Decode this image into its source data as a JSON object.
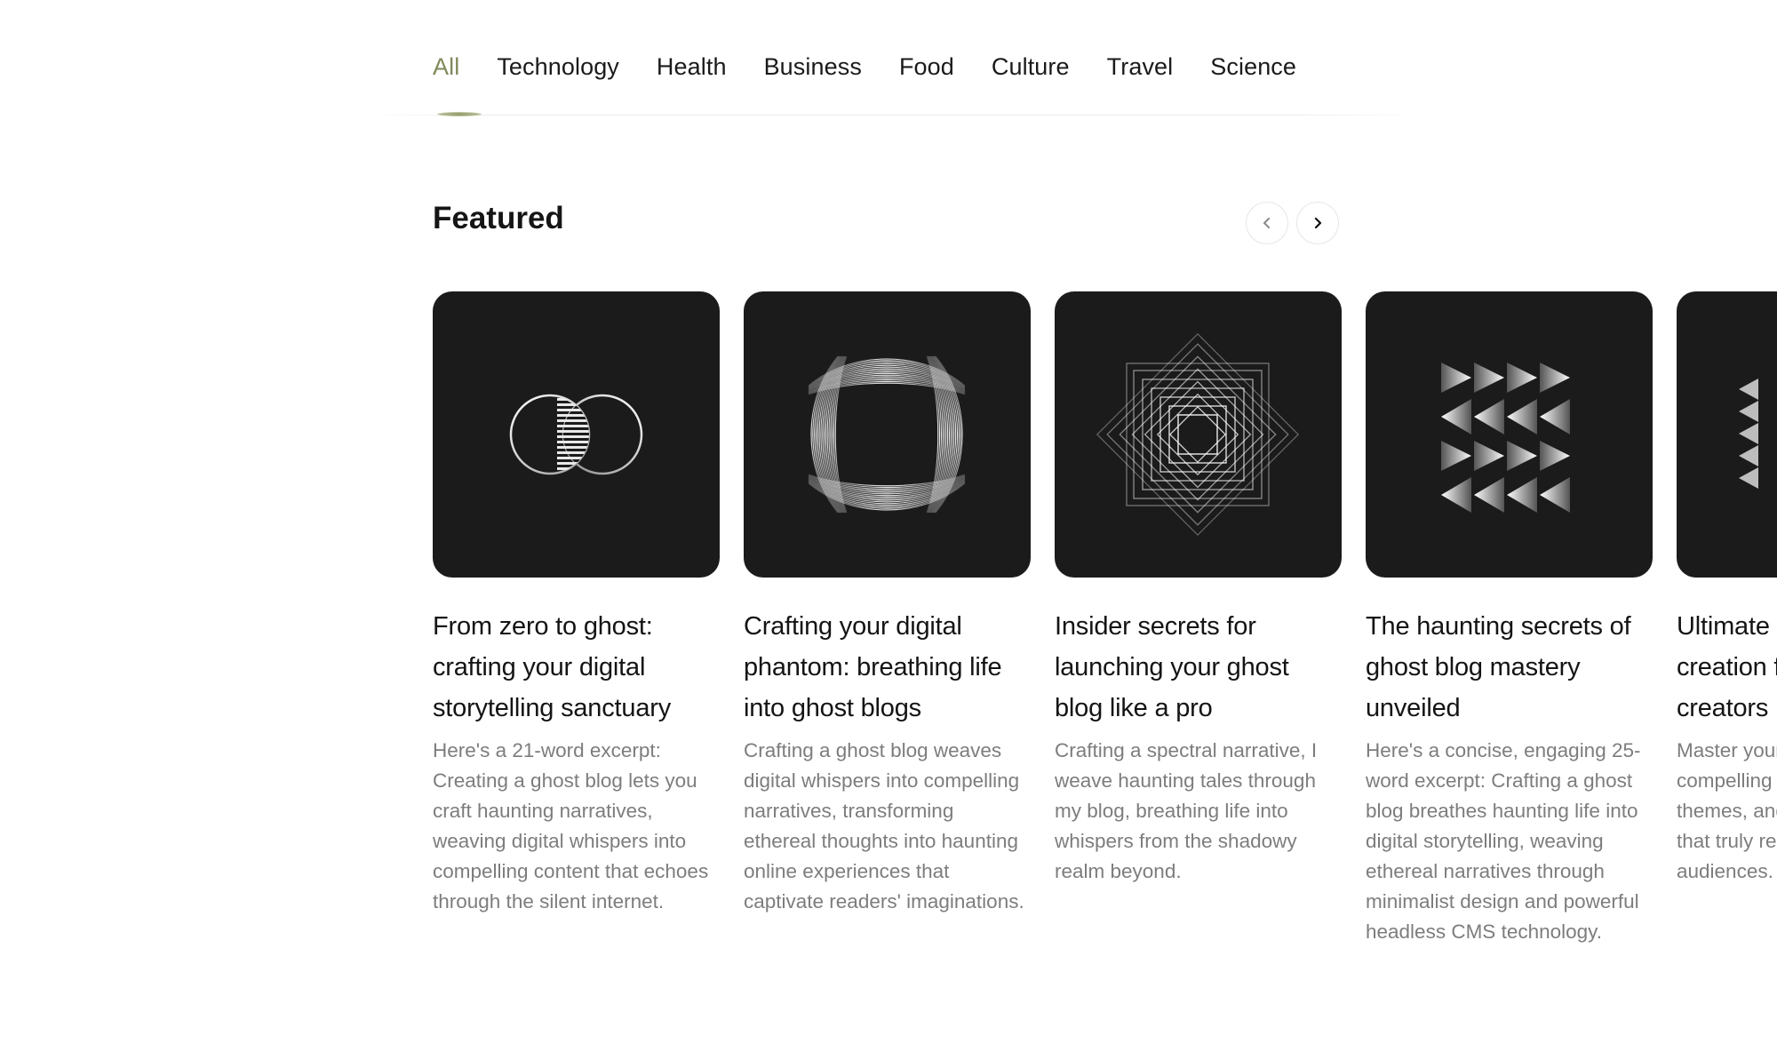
{
  "categories": [
    {
      "label": "All",
      "active": true
    },
    {
      "label": "Technology",
      "active": false
    },
    {
      "label": "Health",
      "active": false
    },
    {
      "label": "Business",
      "active": false
    },
    {
      "label": "Food",
      "active": false
    },
    {
      "label": "Culture",
      "active": false
    },
    {
      "label": "Travel",
      "active": false
    },
    {
      "label": "Science",
      "active": false
    }
  ],
  "featured": {
    "title": "Featured",
    "prev_icon": "chevron-left-icon",
    "next_icon": "chevron-right-icon"
  },
  "cards": [
    {
      "title": "From zero to ghost: crafting your digital storytelling sanctuary",
      "excerpt": "Here's a 21-word excerpt: Creating a ghost blog lets you craft haunting narratives, weaving digital whispers into compelling content that echoes through the silent internet.",
      "art": "overlapping-circles-icon"
    },
    {
      "title": "Crafting your digital phantom: breathing life into ghost blogs",
      "excerpt": "Crafting a ghost blog weaves digital whispers into compelling narratives, transforming ethereal thoughts into haunting online experiences that captivate readers' imaginations.",
      "art": "curved-lines-icon"
    },
    {
      "title": "Insider secrets for launching your ghost blog like a pro",
      "excerpt": "Crafting a spectral narrative, I weave haunting tales through my blog, breathing life into whispers from the shadowy realm beyond.",
      "art": "nested-squares-icon"
    },
    {
      "title": "The haunting secrets of ghost blog mastery unveiled",
      "excerpt": "Here's a concise, engaging 25-word excerpt: Crafting a ghost blog breathes haunting life into digital storytelling, weaving ethereal narratives through minimalist design and powerful headless CMS technology.",
      "art": "triangles-icon"
    },
    {
      "title": "Ultimate guide to content creation for ghost creators",
      "excerpt": "Master your craft with compelling stories, consistent themes, and trends for content that truly resonates with audiences.",
      "art": "triangles-icon"
    }
  ],
  "colors": {
    "accent": "#7f8a5b",
    "card_bg": "#1b1b1b",
    "excerpt": "#7d7d7d"
  }
}
